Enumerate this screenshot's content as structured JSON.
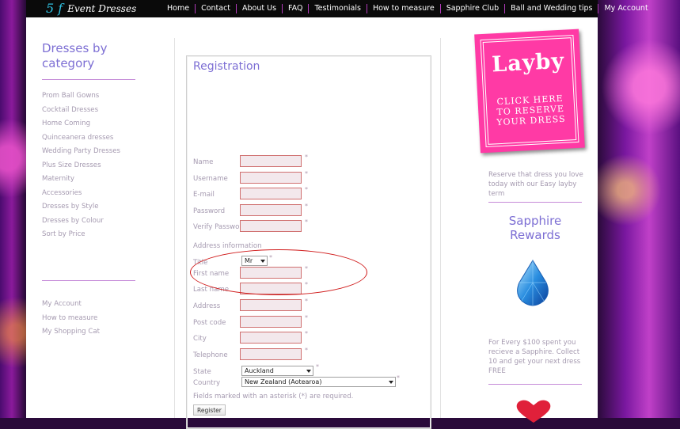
{
  "header": {
    "logo_mark": "5 f",
    "logo_text": "Event Dresses",
    "nav": [
      "Home",
      "Contact",
      "About Us",
      "FAQ",
      "Testimonials",
      "How to measure",
      "Sapphire Club",
      "Ball and Wedding tips",
      "My Account"
    ]
  },
  "sidebar": {
    "title": "Dresses by category",
    "items": [
      "Prom Ball Gowns",
      "Cocktail Dresses",
      "Home Coming",
      "Quinceanera dresses",
      "Wedding Party Dresses",
      "Plus Size Dresses",
      "Maternity",
      "Accessories",
      "Dresses by Style",
      "Dresses by Colour",
      "Sort by Price"
    ],
    "account_items": [
      "My Account",
      "How to measure",
      "My Shopping Cat"
    ]
  },
  "registration": {
    "title": "Registration",
    "fields": [
      "Name",
      "Username",
      "E-mail",
      "Password",
      "Verify Password"
    ],
    "required_mark": "*",
    "address_heading": "Address information",
    "title_label": "Title",
    "title_value": "Mr",
    "address_fields": [
      "First name",
      "Last name",
      "Address",
      "Post code",
      "City",
      "Telephone"
    ],
    "state_label": "State",
    "state_value": "Auckland",
    "country_label": "Country",
    "country_value": "New Zealand (Aotearoa)",
    "note": "Fields marked with an asterisk (*) are required.",
    "button": "Register"
  },
  "right": {
    "layby_big": "Layby",
    "layby_small": "CLICK HERE TO RESERVE YOUR DRESS",
    "layby_text": "Reserve that dress you love today with our Easy layby term",
    "sapphire_title": "Sapphire Rewards",
    "sapphire_text": "For Every $100 spent you recieve a Sapphire. Collect 10 and get your next dress FREE"
  }
}
